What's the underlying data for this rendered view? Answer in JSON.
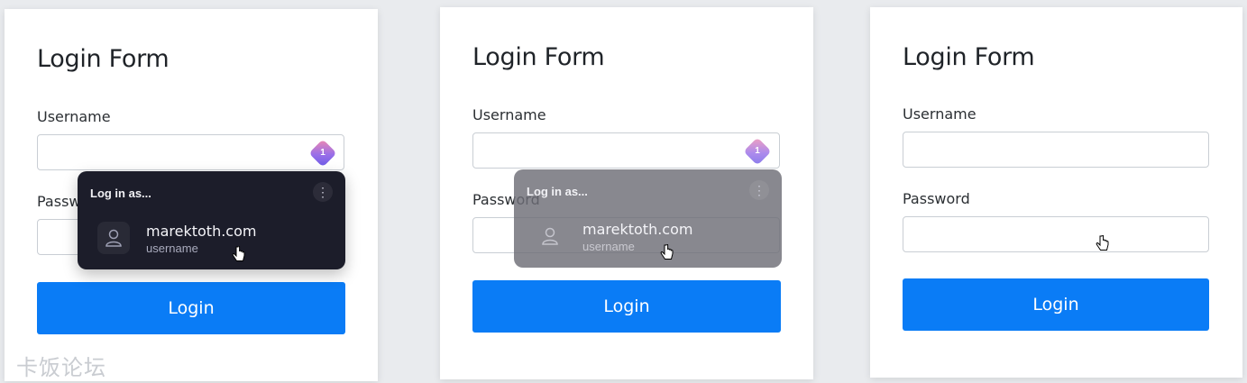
{
  "panels": [
    {
      "title": "Login Form",
      "username_label": "Username",
      "password_label": "Password",
      "login_label": "Login",
      "badge_count": "1",
      "popup": {
        "header": "Log in as...",
        "domain": "marektoth.com",
        "sub": "username"
      }
    },
    {
      "title": "Login Form",
      "username_label": "Username",
      "password_label": "Password",
      "login_label": "Login",
      "badge_count": "1",
      "popup": {
        "header": "Log in as...",
        "domain": "marektoth.com",
        "sub": "username"
      }
    },
    {
      "title": "Login Form",
      "username_label": "Username",
      "password_label": "Password",
      "login_label": "Login"
    }
  ],
  "watermark": "卡饭论坛",
  "colors": {
    "login_button": "#0a7cf6",
    "popup_dark": "#1c1d2a",
    "popup_faded": "#6e6e76"
  }
}
